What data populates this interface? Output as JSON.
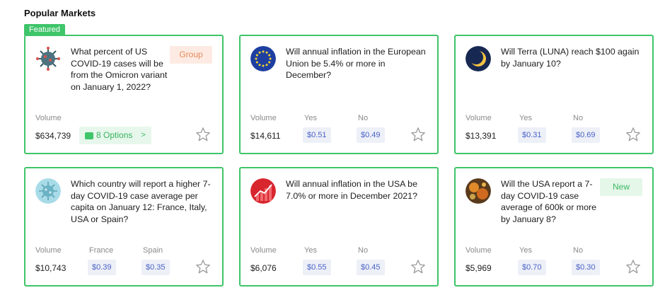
{
  "section_title": "Popular Markets",
  "featured_label": "Featured",
  "labels": {
    "volume": "Volume",
    "yes": "Yes",
    "no": "No",
    "france": "France",
    "spain": "Spain"
  },
  "cards": [
    {
      "icon": "covid-virus-icon",
      "question": "What percent of US COVID-19 cases will be from the Omicron variant on January 1, 2022?",
      "badge": "Group",
      "volume": "$634,739",
      "options_label": "8 Options",
      "options_chevron": ">"
    },
    {
      "icon": "eu-flag-icon",
      "question": "Will annual inflation in the European Union be 5.4% or more in December?",
      "volume": "$14,611",
      "yes": "$0.51",
      "no": "$0.49"
    },
    {
      "icon": "terra-luna-icon",
      "question": "Will Terra (LUNA) reach $100 again by January 10?",
      "volume": "$13,391",
      "yes": "$0.31",
      "no": "$0.69"
    },
    {
      "icon": "covid-virus-blue-icon",
      "question": "Which country will report a higher 7-day COVID-19 case average per capita on January 12: France, Italy, USA or Spain?",
      "volume": "$10,743",
      "france": "$0.39",
      "spain": "$0.35"
    },
    {
      "icon": "inflation-chart-icon",
      "question": "Will annual inflation in the USA be 7.0% or more in December 2021?",
      "volume": "$6,076",
      "yes": "$0.55",
      "no": "$0.45"
    },
    {
      "icon": "covid-virus-orange-icon",
      "question": "Will the USA report a 7-day COVID-19 case average of 600k or more by January 8?",
      "badge": "New",
      "volume": "$5,969",
      "yes": "$0.70",
      "no": "$0.30"
    }
  ]
}
